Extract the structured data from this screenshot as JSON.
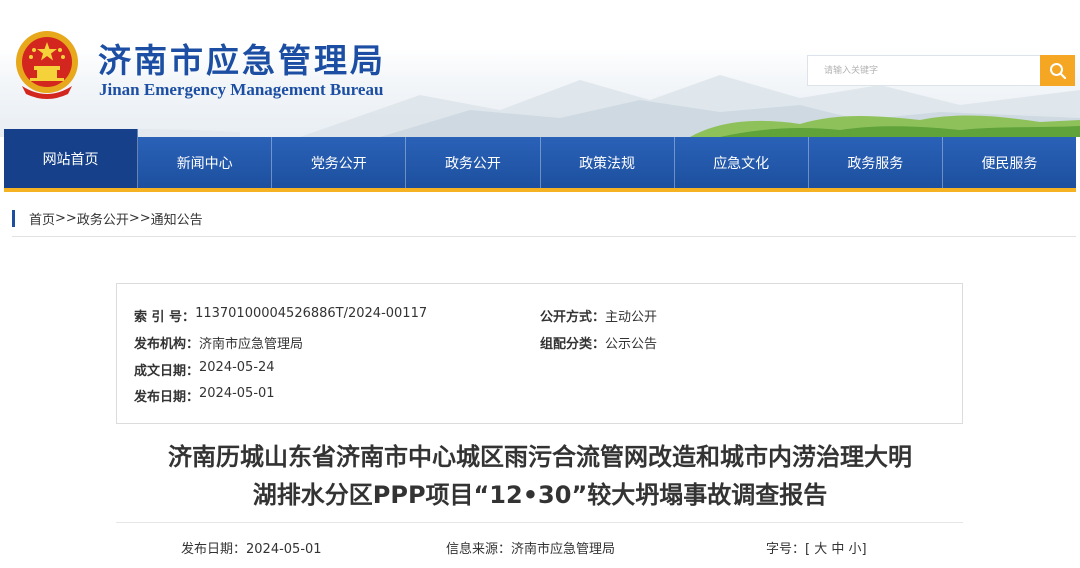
{
  "header": {
    "title": "济南市应急管理局",
    "subtitle": "Jinan Emergency Management Bureau",
    "search_placeholder": "请输入关键字",
    "emblem_icon": "national-emblem-icon",
    "search_icon": "search-icon",
    "colors": {
      "brand_blue": "#1c4fa3",
      "nav_blue": "#1d4f9e",
      "accent_orange": "#f5a623"
    }
  },
  "nav": {
    "items": [
      {
        "label": "网站首页",
        "active": true
      },
      {
        "label": "新闻中心"
      },
      {
        "label": "党务公开"
      },
      {
        "label": "政务公开"
      },
      {
        "label": "政策法规"
      },
      {
        "label": "应急文化"
      },
      {
        "label": "政务服务"
      },
      {
        "label": "便民服务"
      }
    ]
  },
  "breadcrumb": {
    "items": [
      "首页",
      "政务公开",
      "通知公告"
    ],
    "separator": ">>"
  },
  "info": {
    "index_no_label": "索 引 号：",
    "index_no": "11370100004526886T/2024-00117",
    "disclosure_label": "公开方式：",
    "disclosure": "主动公开",
    "issuer_label": "发布机构：",
    "issuer": "济南市应急管理局",
    "category_label": "组配分类：",
    "category": "公示公告",
    "written_date_label": "成文日期：",
    "written_date": "2024-05-24",
    "publish_date_label": "发布日期：",
    "publish_date": "2024-05-01"
  },
  "article": {
    "title_line1": "济南历城山东省济南市中心城区雨污合流管网改造和城市内涝治理大明",
    "title_line2": "湖排水分区PPP项目“12•30”较大坍塌事故调查报告"
  },
  "meta": {
    "date_label": "发布日期：",
    "date": "2024-05-01",
    "source_label": "信息来源：",
    "source": "济南市应急管理局",
    "font_size_label": "字号：[",
    "font_large": "大",
    "font_medium": "中",
    "font_small": "小",
    "font_close": "]"
  }
}
